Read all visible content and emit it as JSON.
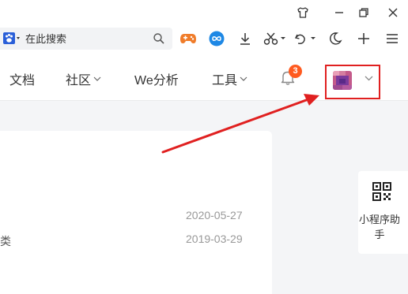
{
  "browser": {
    "search": {
      "placeholder": "在此搜索",
      "value": ""
    },
    "window_controls": [
      "shirt-icon",
      "minimize-icon",
      "restore-icon",
      "close-icon"
    ],
    "toolbar_icons": [
      "gamepad-icon",
      "infinity-icon",
      "download-icon",
      "scissors-icon",
      "undo-icon",
      "moon-icon",
      "plus-icon",
      "menu-icon"
    ]
  },
  "nav": {
    "items": [
      {
        "label": "文档"
      },
      {
        "label": "社区"
      },
      {
        "label": "We分析"
      },
      {
        "label": "工具"
      }
    ],
    "notifications": {
      "count": "3"
    }
  },
  "content": {
    "rows": [
      {
        "text": "",
        "date": "2020-05-27"
      },
      {
        "text": "类",
        "date": "2019-03-29"
      }
    ]
  },
  "side_panel": {
    "label": "小程序助手"
  },
  "colors": {
    "accent_red": "#e02020",
    "badge": "#ff5a1f",
    "gamepad": "#f07c2a",
    "infinity": "#1e88e5"
  }
}
